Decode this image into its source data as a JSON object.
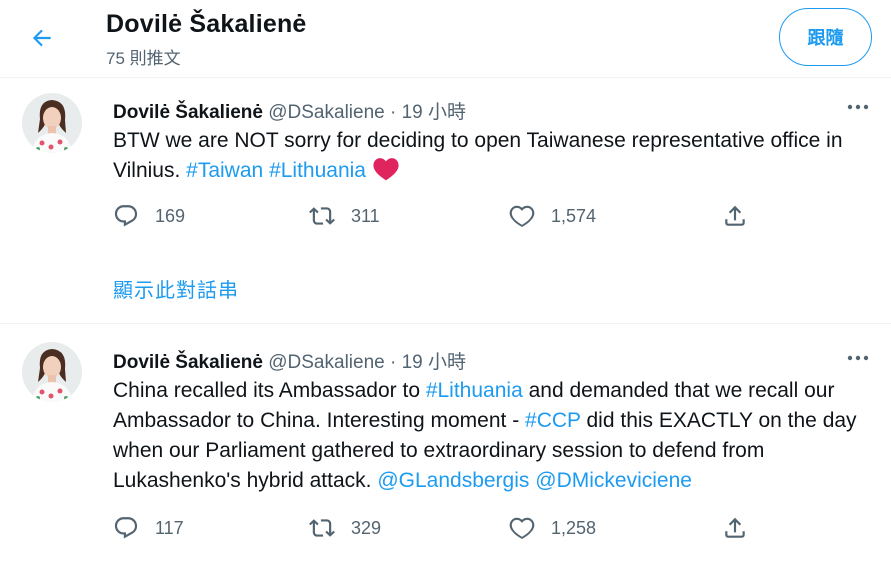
{
  "header": {
    "title": "Dovilė Šakalienė",
    "subtitle": "75 則推文",
    "follow_label": "跟隨",
    "back_icon": "arrow-left-icon"
  },
  "colors": {
    "accent": "#1d9bf0",
    "text": "#0f1419",
    "muted": "#536471",
    "heart": "#e0245e"
  },
  "tweets": [
    {
      "name": "Dovilė Šakalienė",
      "handle": "@DSakaliene",
      "dot": "·",
      "time": "19 小時",
      "text": [
        {
          "t": "BTW we are NOT sorry for deciding to open Taiwanese representative office in Vilnius. "
        },
        {
          "t": "#Taiwan",
          "link": true
        },
        {
          "t": " "
        },
        {
          "t": "#Lithuania",
          "link": true
        },
        {
          "t": " "
        },
        {
          "t": "❤️",
          "emoji": true
        }
      ],
      "replies": "169",
      "retweets": "311",
      "likes": "1,574",
      "show_thread": "顯示此對話串"
    },
    {
      "name": "Dovilė Šakalienė",
      "handle": "@DSakaliene",
      "dot": "·",
      "time": "19 小時",
      "text": [
        {
          "t": "China recalled its Ambassador to "
        },
        {
          "t": "#Lithuania",
          "link": true
        },
        {
          "t": " and demanded that we recall our Ambassador to China. Interesting moment - "
        },
        {
          "t": "#CCP",
          "link": true
        },
        {
          "t": " did this EXACTLY on the day when our Parliament gathered to extraordinary session to defend from Lukashenko's hybrid attack. "
        },
        {
          "t": "@GLandsbergis",
          "link": true
        },
        {
          "t": " "
        },
        {
          "t": "@DMickeviciene",
          "link": true
        }
      ],
      "replies": "117",
      "retweets": "329",
      "likes": "1,258"
    }
  ]
}
